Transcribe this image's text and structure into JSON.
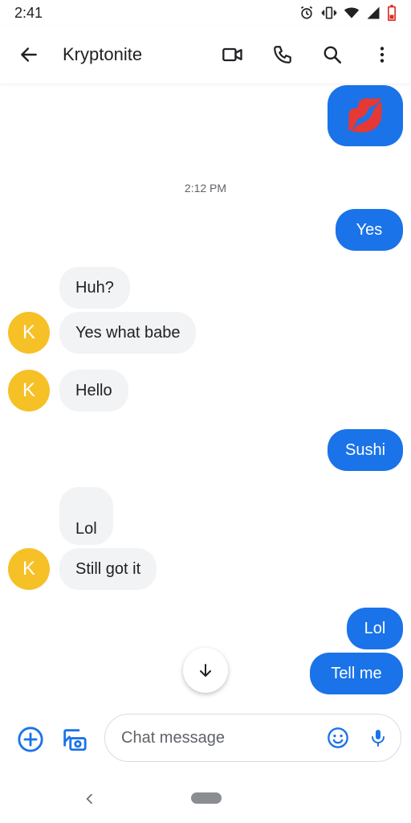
{
  "status_bar": {
    "time": "2:41"
  },
  "header": {
    "title": "Kryptonite"
  },
  "messages": {
    "out_1_emoji": "💋",
    "timestamp": "2:12 PM",
    "out_2": "Yes",
    "in_1": "Huh?",
    "in_2": "Yes what babe",
    "in_3": "Hello",
    "out_3": "Sushi",
    "in_4": "Lol",
    "in_5": "Still got it",
    "out_4": "Lol",
    "out_5": "Tell me"
  },
  "avatar_initial": "K",
  "compose": {
    "placeholder": "Chat message"
  },
  "colors": {
    "accent": "#1a73e8",
    "avatar": "#f6c027",
    "incoming_bubble": "#f1f3f4"
  }
}
